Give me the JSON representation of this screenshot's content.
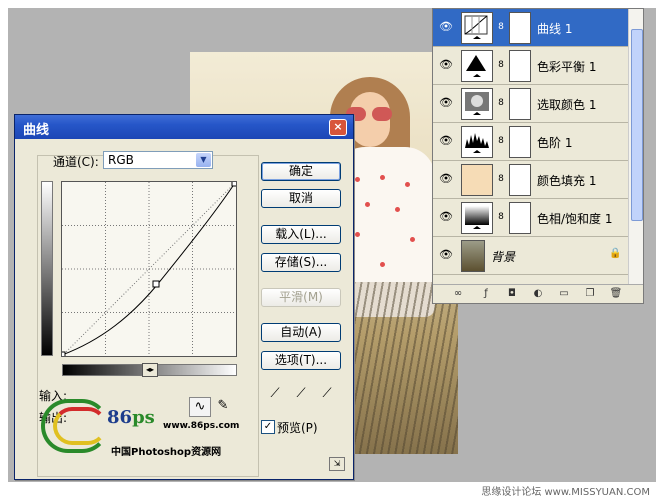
{
  "curves_dialog": {
    "title": "曲线",
    "close_label": "×",
    "channel_label": "通道(C):",
    "channel_value": "RGB",
    "input_label": "输入:",
    "output_label": "输出:",
    "buttons": {
      "ok": "确定",
      "cancel": "取消",
      "load": "载入(L)...",
      "save": "存储(S)...",
      "smooth": "平滑(M)",
      "auto": "自动(A)",
      "options": "选项(T)..."
    },
    "preview_label": "预览(P)",
    "preview_checked": "✓",
    "logo": {
      "number": "86",
      "ps": "ps",
      "url": "www.86ps.com",
      "caption": "中国Photoshop资源网"
    }
  },
  "layers_panel": {
    "layers": [
      {
        "name": "曲线 1",
        "thumb": "curves-adjustment-icon",
        "active": true
      },
      {
        "name": "色彩平衡 1",
        "thumb": "color-balance-icon",
        "active": false
      },
      {
        "name": "选取颜色 1",
        "thumb": "selective-color-icon",
        "active": false
      },
      {
        "name": "色阶 1",
        "thumb": "levels-icon",
        "active": false
      },
      {
        "name": "颜色填充 1",
        "thumb": "color-fill-swatch",
        "swatch": "#f6dcb6",
        "active": false
      },
      {
        "name": "色相/饱和度 1",
        "thumb": "hue-saturation-icon",
        "active": false
      },
      {
        "name": "背景",
        "thumb": "background-photo",
        "active": false
      }
    ]
  },
  "watermark": "思缘设计论坛  www.MISSYUAN.COM"
}
